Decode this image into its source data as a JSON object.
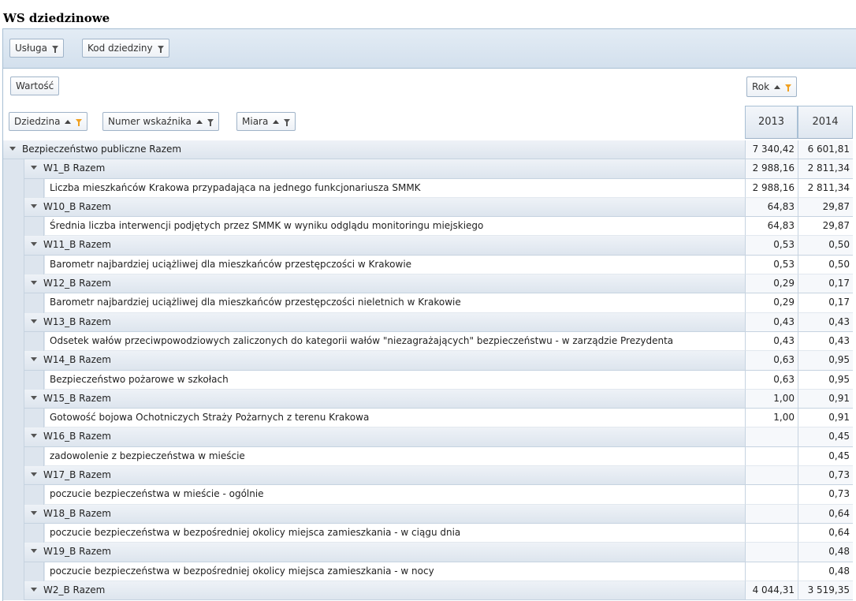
{
  "page": {
    "title": "WS dziedzinowe"
  },
  "filters": {
    "usluga": "Usługa",
    "kod": "Kod dziedziny"
  },
  "data_field": "Wartość",
  "column_field": "Rok",
  "row_fields": {
    "dziedzina": "Dziedzina",
    "numer": "Numer wskaźnika",
    "miara": "Miara"
  },
  "columns": [
    "2013",
    "2014"
  ],
  "rows": [
    {
      "type": "top",
      "label": "Bezpieczeństwo publiczne Razem",
      "v2013": "7 340,42",
      "v2014": "6 601,81"
    },
    {
      "type": "group",
      "label": "W1_B Razem",
      "v2013": "2 988,16",
      "v2014": "2 811,34"
    },
    {
      "type": "detail",
      "label": "Liczba mieszkańców Krakowa przypadająca na jednego funkcjonariusza SMMK",
      "v2013": "2 988,16",
      "v2014": "2 811,34"
    },
    {
      "type": "group",
      "label": "W10_B Razem",
      "v2013": "64,83",
      "v2014": "29,87"
    },
    {
      "type": "detail",
      "label": "Średnia liczba interwencji podjętych przez SMMK w wyniku odglądu monitoringu miejskiego",
      "v2013": "64,83",
      "v2014": "29,87"
    },
    {
      "type": "group",
      "label": "W11_B Razem",
      "v2013": "0,53",
      "v2014": "0,50"
    },
    {
      "type": "detail",
      "label": "Barometr najbardziej uciążliwej dla mieszkańców przestępczości w Krakowie",
      "v2013": "0,53",
      "v2014": "0,50"
    },
    {
      "type": "group",
      "label": "W12_B Razem",
      "v2013": "0,29",
      "v2014": "0,17"
    },
    {
      "type": "detail",
      "label": "Barometr najbardziej uciążliwej dla mieszkańców przestępczości nieletnich w Krakowie",
      "v2013": "0,29",
      "v2014": "0,17"
    },
    {
      "type": "group",
      "label": "W13_B Razem",
      "v2013": "0,43",
      "v2014": "0,43"
    },
    {
      "type": "detail",
      "label": "Odsetek wałów przeciwpowodziowych zaliczonych do kategorii wałów \"niezagrażających\" bezpieczeństwu - w zarządzie Prezydenta",
      "v2013": "0,43",
      "v2014": "0,43"
    },
    {
      "type": "group",
      "label": "W14_B Razem",
      "v2013": "0,63",
      "v2014": "0,95"
    },
    {
      "type": "detail",
      "label": "Bezpieczeństwo pożarowe w szkołach",
      "v2013": "0,63",
      "v2014": "0,95"
    },
    {
      "type": "group",
      "label": "W15_B Razem",
      "v2013": "1,00",
      "v2014": "0,91"
    },
    {
      "type": "detail",
      "label": "Gotowość bojowa Ochotniczych Straży Pożarnych z terenu Krakowa",
      "v2013": "1,00",
      "v2014": "0,91"
    },
    {
      "type": "group",
      "label": "W16_B Razem",
      "v2013": "",
      "v2014": "0,45"
    },
    {
      "type": "detail",
      "label": "zadowolenie z bezpieczeństwa w mieście",
      "v2013": "",
      "v2014": "0,45"
    },
    {
      "type": "group",
      "label": "W17_B Razem",
      "v2013": "",
      "v2014": "0,73"
    },
    {
      "type": "detail",
      "label": "poczucie bezpieczeństwa w mieście - ogólnie",
      "v2013": "",
      "v2014": "0,73"
    },
    {
      "type": "group",
      "label": "W18_B Razem",
      "v2013": "",
      "v2014": "0,64"
    },
    {
      "type": "detail",
      "label": "poczucie bezpieczeństwa w bezpośredniej okolicy miejsca zamieszkania - w ciągu dnia",
      "v2013": "",
      "v2014": "0,64"
    },
    {
      "type": "group",
      "label": "W19_B Razem",
      "v2013": "",
      "v2014": "0,48"
    },
    {
      "type": "detail",
      "label": "poczucie bezpieczeństwa w bezpośredniej okolicy miejsca zamieszkania - w nocy",
      "v2013": "",
      "v2014": "0,48"
    },
    {
      "type": "group",
      "label": "W2_B Razem",
      "v2013": "4 044,31",
      "v2014": "3 519,35"
    }
  ]
}
